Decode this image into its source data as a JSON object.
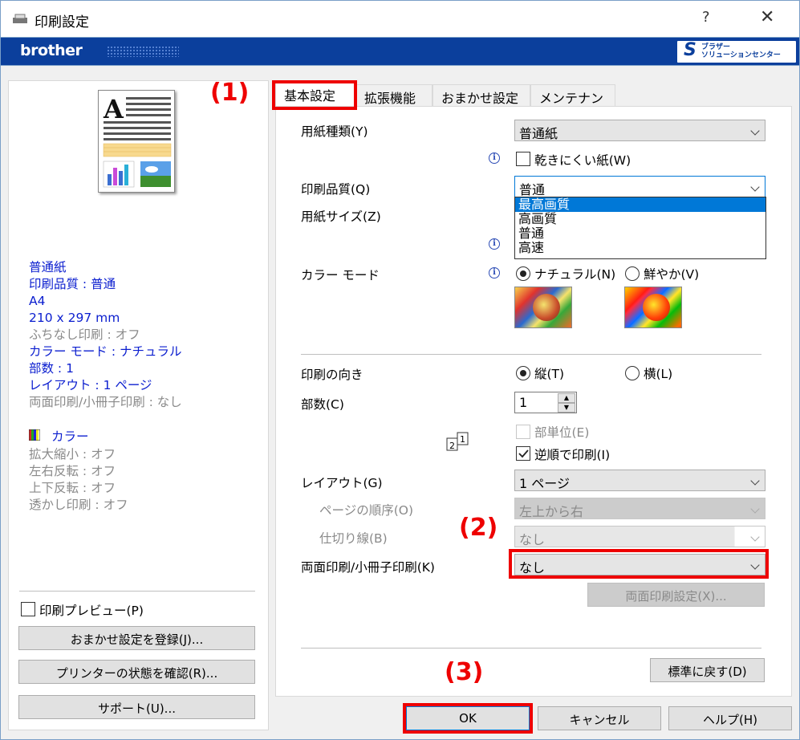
{
  "window": {
    "title": "印刷設定",
    "help_label": "?",
    "close_label": "✕"
  },
  "brand": {
    "logo": "brother",
    "solutions_line1": "ブラザー",
    "solutions_line2": "ソリューションセンター"
  },
  "annotations": {
    "a1": "(1)",
    "a2": "(2)",
    "a3": "(3)"
  },
  "tabs": [
    {
      "label": "基本設定"
    },
    {
      "label": "拡張機能"
    },
    {
      "label": "おまかせ設定"
    },
    {
      "label": "メンテナンス"
    }
  ],
  "summary": {
    "items": [
      "普通紙",
      "印刷品質 : 普通",
      "A4",
      "210 x 297 mm",
      "ふちなし印刷 : オフ",
      "カラー モード : ナチュラル",
      "部数 : 1",
      "レイアウト : 1 ページ",
      "両面印刷/小冊子印刷 : なし"
    ],
    "color_label": "カラー",
    "color_items": [
      "拡大縮小 : オフ",
      "左右反転 : オフ",
      "上下反転 : オフ",
      "透かし印刷 : オフ"
    ]
  },
  "left_buttons": {
    "preview_label": "印刷プレビュー(P)",
    "register": "おまかせ設定を登録(J)...",
    "status": "プリンターの状態を確認(R)...",
    "support": "サポート(U)..."
  },
  "form": {
    "media_type_label": "用紙種類(Y)",
    "media_type_value": "普通紙",
    "slow_dry_label": "乾きにくい紙(W)",
    "quality_label": "印刷品質(Q)",
    "quality_value": "普通",
    "quality_options": [
      "最高画質",
      "高画質",
      "普通",
      "高速"
    ],
    "paper_size_label": "用紙サイズ(Z)",
    "color_mode_label": "カラー モード",
    "color_natural": "ナチュラル(N)",
    "color_vivid": "鮮やか(V)",
    "orientation_label": "印刷の向き",
    "portrait": "縦(T)",
    "landscape": "横(L)",
    "copies_label": "部数(C)",
    "copies_value": "1",
    "collate_label": "部単位(E)",
    "reverse_label": "逆順で印刷(I)",
    "layout_label": "レイアウト(G)",
    "layout_value": "1 ページ",
    "page_order_label": "ページの順序(O)",
    "page_order_value": "左上から右",
    "border_label": "仕切り線(B)",
    "border_value": "なし",
    "duplex_label": "両面印刷/小冊子印刷(K)",
    "duplex_value": "なし",
    "duplex_settings": "両面印刷設定(X)...",
    "default_button": "標準に戻す(D)"
  },
  "footer": {
    "ok": "OK",
    "cancel": "キャンセル",
    "help": "ヘルプ(H)"
  },
  "colors": {
    "brand": "#0b3f9c",
    "annotation": "#ee0000",
    "summary_text": "#0b1ecf"
  }
}
